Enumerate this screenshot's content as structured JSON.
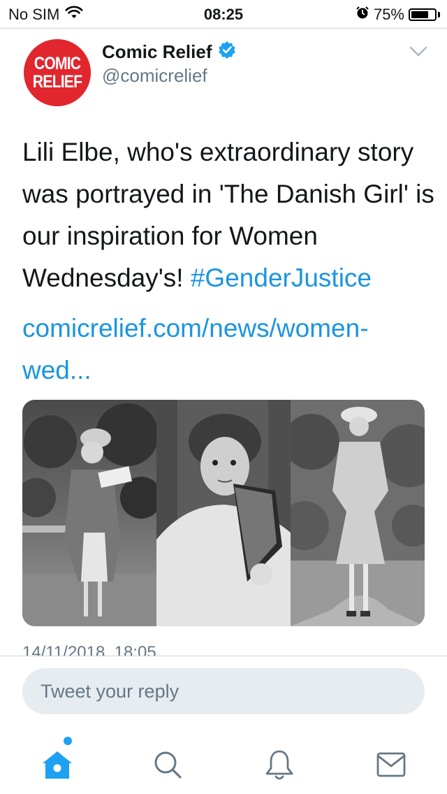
{
  "status_bar": {
    "carrier": "No SIM",
    "time": "08:25",
    "battery_percent": "75%",
    "battery_level": 0.75,
    "icons": [
      "wifi-icon",
      "alarm-icon",
      "battery-icon"
    ]
  },
  "tweet": {
    "avatar_text_line1": "COMIC",
    "avatar_text_line2": "RELIEF",
    "display_name": "Comic Relief",
    "handle": "@comicrelief",
    "verified": true,
    "text_plain": "Lili Elbe, who's extraordinary story was portrayed in 'The Danish Girl' is our inspiration for Women Wednesday's!",
    "hashtag": "#GenderJustice",
    "link": "comicrelief.com/news/women-wed...",
    "timestamp": "14/11/2018, 18:05",
    "media_count": 3
  },
  "reply": {
    "placeholder": "Tweet your reply"
  },
  "tab_bar": {
    "items": [
      "home-icon",
      "search-icon",
      "notifications-icon",
      "messages-icon"
    ],
    "active": "home-icon",
    "accent_color": "#1da1f2"
  },
  "colors": {
    "brand_red": "#e1262d",
    "link_blue": "#1b95e0",
    "verified_blue": "#1da1f2",
    "secondary_text": "#657786"
  }
}
